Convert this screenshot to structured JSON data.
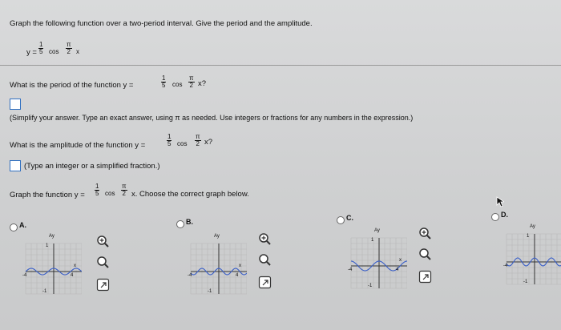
{
  "instruction": "Graph the following function over a two-period interval. Give the period and the amplitude.",
  "fn": {
    "y": "y =",
    "num": "1",
    "den": "5",
    "cos": "cos",
    "pi": "π",
    "two": "2",
    "x": "x"
  },
  "q1": {
    "prefix": "What is the period of the function y =",
    "suffix": "x?"
  },
  "hint1": "(Simplify your answer. Type an exact answer, using π as needed. Use integers or fractions for any numbers in the expression.)",
  "q2": {
    "prefix": "What is the amplitude of the function y =",
    "suffix": "x?"
  },
  "hint2": "(Type an integer or a simplified fraction.)",
  "q3": {
    "prefix": "Graph the function y =",
    "suffix": "x. Choose the correct graph below."
  },
  "options": [
    {
      "label": "A.",
      "ticks": {
        "top": "1",
        "left": "-4",
        "right": "4",
        "bottom": "-1",
        "x": "x",
        "y": "Ay"
      }
    },
    {
      "label": "B.",
      "ticks": {
        "top": "",
        "left": "-4",
        "right": "4",
        "bottom": "-1",
        "x": "x",
        "y": "Ay"
      }
    },
    {
      "label": "C.",
      "ticks": {
        "top": "1",
        "left": "-4",
        "right": "4",
        "bottom": "-1",
        "x": "x",
        "y": "Ay"
      }
    },
    {
      "label": "D.",
      "ticks": {
        "top": "1",
        "left": "-4",
        "right": "",
        "bottom": "-1",
        "x": "",
        "y": "Ay"
      }
    }
  ],
  "icons": {
    "zoom_in": "zoom-in-icon",
    "zoom_out": "zoom-out-icon",
    "external": "open-external-icon"
  },
  "colors": {
    "accent": "#2f6fc0",
    "curve": "#3a5fc8",
    "text": "#111111"
  }
}
